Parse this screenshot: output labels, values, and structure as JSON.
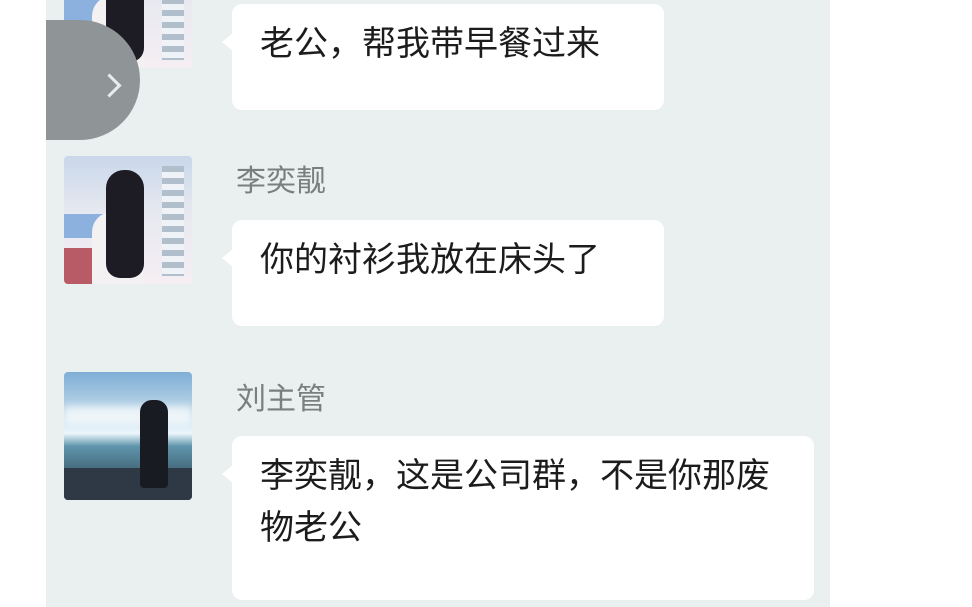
{
  "messages": [
    {
      "sender": "",
      "text": "老公，帮我带早餐过来",
      "avatar": "girl-photo-avatar"
    },
    {
      "sender": "李奕靓",
      "text": "你的衬衫我放在床头了",
      "avatar": "girl-photo-avatar"
    },
    {
      "sender": "刘主管",
      "text": "李奕靓，这是公司群，不是你那废物老公",
      "avatar": "beach-photo-avatar"
    }
  ],
  "controls": {
    "collapse_icon": "chevron-right-icon"
  },
  "colors": {
    "panel_background": "#eaeff0",
    "bubble_background": "#ffffff",
    "name_text": "#77807f",
    "message_text": "#1c1c1c",
    "collapse_tab": "#8f9496"
  }
}
